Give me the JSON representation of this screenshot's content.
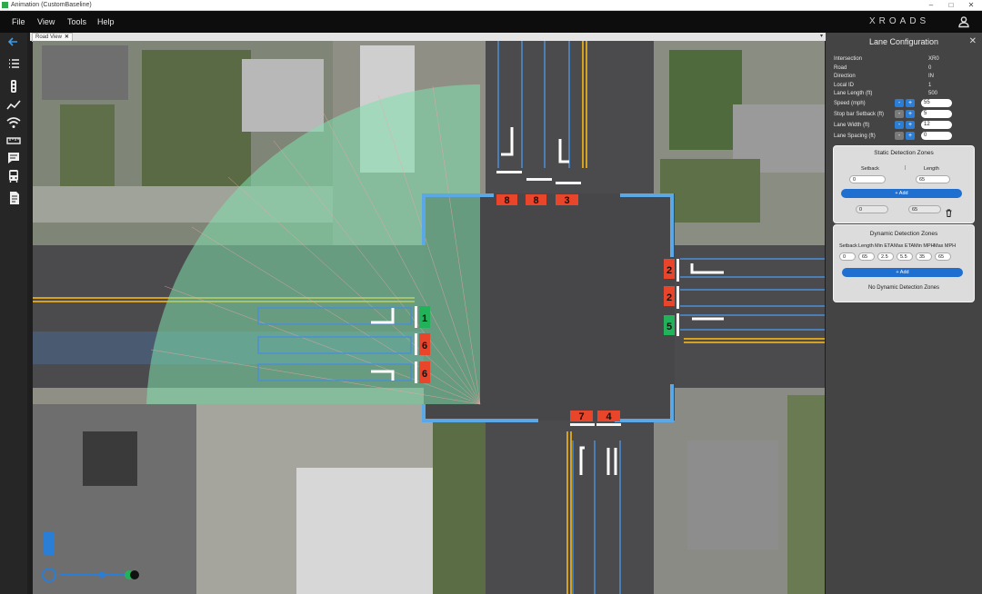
{
  "window": {
    "title": "Animation (CustomBaseline)",
    "controls": [
      "–",
      "□",
      "✕"
    ]
  },
  "menu": {
    "items": [
      "File",
      "View",
      "Tools",
      "Help"
    ],
    "brand": "XROADS"
  },
  "rail": {
    "icons": [
      "back-arrow-icon",
      "list-icon",
      "traffic-light-icon",
      "line-chart-icon",
      "wifi-icon",
      "ruler-icon",
      "message-icon",
      "bus-icon",
      "report-icon"
    ]
  },
  "tabs": {
    "active": "Road View",
    "close": "✕",
    "menu": "▾"
  },
  "zones": {
    "north_inbound": [
      "8",
      "8",
      "3"
    ],
    "east_inbound": [
      "2",
      "2",
      "5"
    ],
    "west_inbound": [
      "1",
      "6",
      "6"
    ],
    "south_inbound": [
      "7",
      "4"
    ],
    "colors": {
      "red": "#e8452b",
      "green": "#22b35a",
      "highlight": "#5fd19b"
    }
  },
  "panel": {
    "title": "Lane Configuration",
    "close": "✕",
    "props": [
      {
        "label": "Intersection",
        "value": "XR0"
      },
      {
        "label": "Road",
        "value": "0"
      },
      {
        "label": "Direction",
        "value": "IN"
      },
      {
        "label": "Local ID",
        "value": "1"
      },
      {
        "label": "Lane Length (ft)",
        "value": "500"
      }
    ],
    "editable_props": [
      {
        "label": "Speed (mph)",
        "value": "55"
      },
      {
        "label": "Stop bar Setback (ft)",
        "value": "5"
      },
      {
        "label": "Lane Width (ft)",
        "value": "12"
      },
      {
        "label": "Lane Spacing (ft)",
        "value": "0"
      }
    ],
    "stepper_minus": "-",
    "stepper_plus": "+",
    "static": {
      "title": "Static Detection Zones",
      "setback_label": "Setback",
      "length_label": "Length",
      "setback_value": "0",
      "length_value": "65",
      "add_label": "+ Add",
      "zone_setback": "0",
      "zone_length": "65"
    },
    "dynamic": {
      "title": "Dynamic Detection Zones",
      "headers": [
        "Setback",
        "Length",
        "Min ETA",
        "Max ETA",
        "Min MPH",
        "Max MPH"
      ],
      "values": [
        "0",
        "65",
        "2.5",
        "5.5",
        "35",
        "65"
      ],
      "add_label": "+ Add",
      "empty_text": "No Dynamic Detection Zones"
    }
  }
}
